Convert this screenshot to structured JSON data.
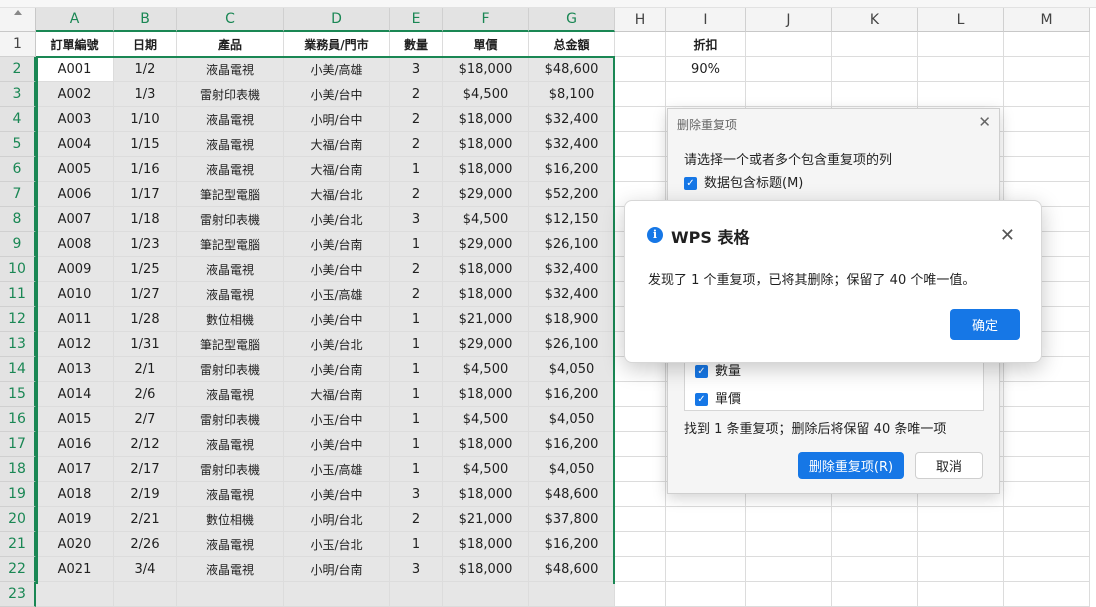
{
  "columns": [
    "A",
    "B",
    "C",
    "D",
    "E",
    "F",
    "G",
    "H",
    "I",
    "J",
    "K",
    "L",
    "M"
  ],
  "headers": [
    "訂單編號",
    "日期",
    "產品",
    "業務員/門市",
    "數量",
    "單價",
    "总金額"
  ],
  "discount_label": "折扣",
  "discount_value": "90%",
  "rows": [
    [
      "A001",
      "1/2",
      "液晶電視",
      "小美/高雄",
      "3",
      "$18,000",
      "$48,600"
    ],
    [
      "A002",
      "1/3",
      "雷射印表機",
      "小美/台中",
      "2",
      "$4,500",
      "$8,100"
    ],
    [
      "A003",
      "1/10",
      "液晶電視",
      "小明/台中",
      "2",
      "$18,000",
      "$32,400"
    ],
    [
      "A004",
      "1/15",
      "液晶電視",
      "大福/台南",
      "2",
      "$18,000",
      "$32,400"
    ],
    [
      "A005",
      "1/16",
      "液晶電視",
      "大福/台南",
      "1",
      "$18,000",
      "$16,200"
    ],
    [
      "A006",
      "1/17",
      "筆記型電腦",
      "大福/台北",
      "2",
      "$29,000",
      "$52,200"
    ],
    [
      "A007",
      "1/18",
      "雷射印表機",
      "小美/台北",
      "3",
      "$4,500",
      "$12,150"
    ],
    [
      "A008",
      "1/23",
      "筆記型電腦",
      "小美/台南",
      "1",
      "$29,000",
      "$26,100"
    ],
    [
      "A009",
      "1/25",
      "液晶電視",
      "小美/台中",
      "2",
      "$18,000",
      "$32,400"
    ],
    [
      "A010",
      "1/27",
      "液晶電視",
      "小玉/高雄",
      "2",
      "$18,000",
      "$32,400"
    ],
    [
      "A011",
      "1/28",
      "數位相機",
      "小美/台中",
      "1",
      "$21,000",
      "$18,900"
    ],
    [
      "A012",
      "1/31",
      "筆記型電腦",
      "小美/台北",
      "1",
      "$29,000",
      "$26,100"
    ],
    [
      "A013",
      "2/1",
      "雷射印表機",
      "小美/台南",
      "1",
      "$4,500",
      "$4,050"
    ],
    [
      "A014",
      "2/6",
      "液晶電視",
      "大福/台南",
      "1",
      "$18,000",
      "$16,200"
    ],
    [
      "A015",
      "2/7",
      "雷射印表機",
      "小玉/台中",
      "1",
      "$4,500",
      "$4,050"
    ],
    [
      "A016",
      "2/12",
      "液晶電視",
      "小美/台中",
      "1",
      "$18,000",
      "$16,200"
    ],
    [
      "A017",
      "2/17",
      "雷射印表機",
      "小玉/高雄",
      "1",
      "$4,500",
      "$4,050"
    ],
    [
      "A018",
      "2/19",
      "液晶電視",
      "小美/台中",
      "3",
      "$18,000",
      "$48,600"
    ],
    [
      "A019",
      "2/21",
      "數位相機",
      "小明/台北",
      "2",
      "$21,000",
      "$37,800"
    ],
    [
      "A020",
      "2/26",
      "液晶電視",
      "小玉/台北",
      "1",
      "$18,000",
      "$16,200"
    ],
    [
      "A021",
      "3/4",
      "液晶電視",
      "小明/台南",
      "3",
      "$18,000",
      "$48,600"
    ]
  ],
  "bg_dialog": {
    "title": "删除重复项",
    "prompt": "请选择一个或者多个包含重复项的列",
    "header_checkbox": "数据包含标题(M)",
    "list_items": [
      "數量",
      "單價"
    ],
    "found_text": "找到 1 条重复项；删除后将保留 40 条唯一项",
    "remove_button": "删除重复项(R)",
    "cancel_button": "取消"
  },
  "alert": {
    "title": "WPS 表格",
    "message": "发现了 1 个重复项，已将其删除；保留了 40 个唯一值。",
    "ok_button": "确定"
  },
  "colors": {
    "accent": "#1677e6",
    "selection": "#1a8754"
  }
}
